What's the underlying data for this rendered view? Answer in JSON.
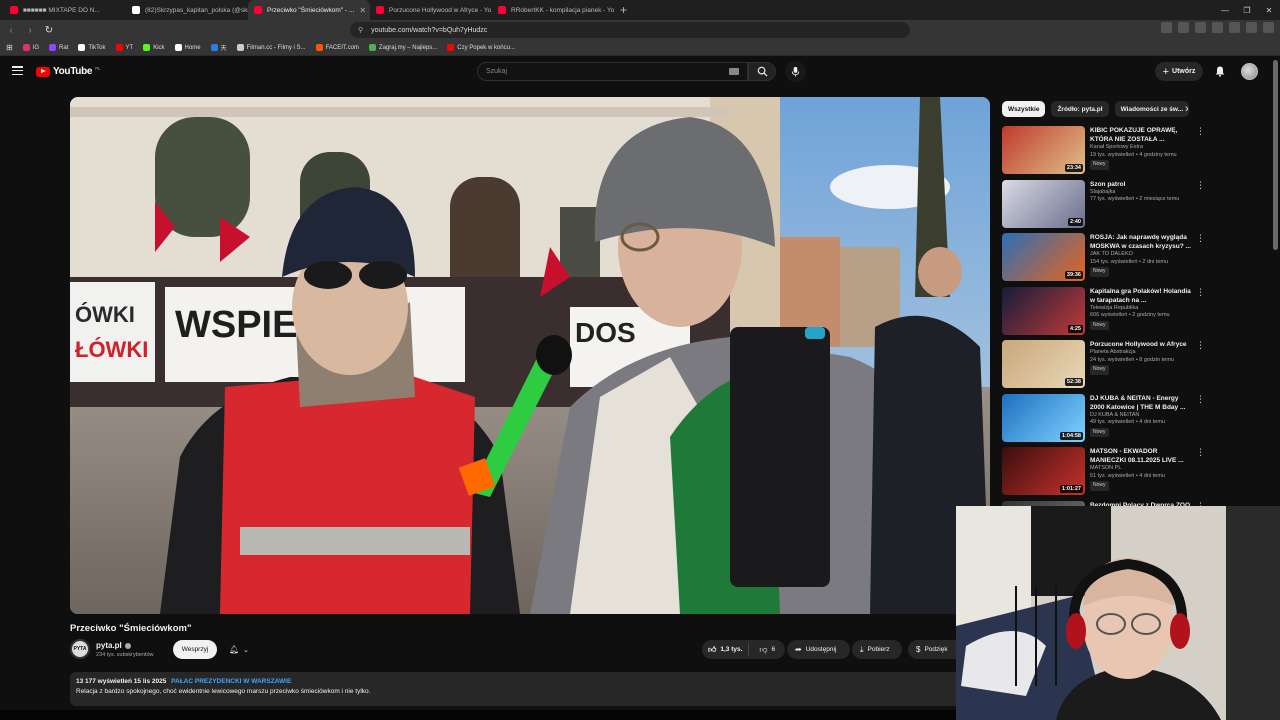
{
  "browser": {
    "tabs": [
      {
        "title": "■■■■■■ MIXTAPE DO N...",
        "color": "#ff0033"
      },
      {
        "title": "(82)Skrzypas_kapitan_polska (@skrzy...",
        "color": "#ffffff"
      },
      {
        "title": "Przeciwko \"Śmieciówkom\" - ...",
        "color": "#ff0033",
        "active": true
      },
      {
        "title": "Porzucone Hollywood w Afryce - Yo...",
        "color": "#ff0033"
      },
      {
        "title": "RRobertKK - kompilacja pianek - Yo...",
        "color": "#ff0033"
      }
    ],
    "url": "youtube.com/watch?v=bQuh7yHudzc",
    "bookmarks": [
      {
        "label": "IG",
        "color": "#e1306c"
      },
      {
        "label": "Rat",
        "color": "#9146ff"
      },
      {
        "label": "TikTok",
        "color": "#ffffff"
      },
      {
        "label": "YT",
        "color": "#ff0000"
      },
      {
        "label": "Kick",
        "color": "#53fc18"
      },
      {
        "label": "Home",
        "color": "#ffffff"
      },
      {
        "label": "天",
        "color": "#2b7de9"
      },
      {
        "label": "Filman.cc - Filmy i S...",
        "color": "#cccccc"
      },
      {
        "label": "FACEIT.com",
        "color": "#ff5500"
      },
      {
        "label": "Zagraj.my – Najleps...",
        "color": "#4caf50"
      },
      {
        "label": "Czy Popek w końcu...",
        "color": "#ff0000"
      }
    ]
  },
  "youtube": {
    "logo_text": "YouTube",
    "logo_country": "PL",
    "search_placeholder": "Szukaj",
    "create_label": "Utwórz"
  },
  "video": {
    "title": "Przeciwko \"Śmieciówkom\"",
    "channel": "pyta.pl",
    "channel_avatar_text": "PYTA",
    "subscribers": "234 tys. subskrybentów",
    "support_label": "Wesprzyj",
    "likes": "1,3 tys.",
    "dislikes": "6",
    "share_label": "Udostępnij",
    "download_label": "Pobierz",
    "thanks_label": "Podzięk",
    "views_date": "13 177 wyświetleń  15 lis 2025",
    "location_tag": "PAŁAC PREZYDENCKI W WARSZAWIE",
    "description": "Relacja z bardzo spokojnego, choć ewidentnie lewicowego marszu przeciwko śmieciówkom i nie tylko."
  },
  "sidebar": {
    "chips": [
      "Wszystkie",
      "Źródło: pyta.pl",
      "Wiadomości ze św..."
    ],
    "items": [
      {
        "title": "KIBIC POKAZUJE OPRAWĘ, KTÓRA NIE ZOSTAŁA ...",
        "channel": "Kanał Sportowy Extra",
        "meta": "19 tys. wyświetleń • 4 godziny temu",
        "duration": "23:34",
        "badge": "Nowy",
        "c1": "#c0392b",
        "c2": "#e0c08a"
      },
      {
        "title": "Szon patrol",
        "channel": "Slajabajka",
        "meta": "77 tys. wyświetleń • 2 miesiące temu",
        "duration": "2:40",
        "badge": "",
        "c1": "#d9dbe4",
        "c2": "#6b6e8f"
      },
      {
        "title": "ROSJA: Jak naprawdę wygląda MOSKWA w czasach kryzysu? ...",
        "channel": "JAK TO DALEKO",
        "meta": "154 tys. wyświetleń • 2 dni temu",
        "duration": "39:36",
        "badge": "Nowy",
        "c1": "#2a6fb5",
        "c2": "#e8641c"
      },
      {
        "title": "Kapitalna gra Polaków! Holandia w tarapatach na ...",
        "channel": "Telewizja Republika",
        "meta": "606 wyświetleń • 2 godziny temu",
        "duration": "4:25",
        "badge": "Nowy",
        "c1": "#141c3a",
        "c2": "#c23a3a"
      },
      {
        "title": "Porzucone Hollywood w Afryce",
        "channel": "Planeta Abstrakcja",
        "meta": "24 tys. wyświetleń • 8 godzin temu",
        "duration": "52:38",
        "badge": "Nowy",
        "c1": "#c9a77a",
        "c2": "#e8d8b8"
      },
      {
        "title": "DJ KUBA & NEITAN - Energy 2000 Katowice | THE M Bday ...",
        "channel": "DJ KUBA & NEITAN",
        "meta": "49 tys. wyświetleń • 4 dni temu",
        "duration": "1:04:58",
        "badge": "Nowy",
        "c1": "#1d6fbf",
        "c2": "#7fd3ff"
      },
      {
        "title": "MATSON - EKWADOR MANIECZKI 08.11.2025 LIVE ...",
        "channel": "MATSON PL",
        "meta": "51 tys. wyświetleń • 4 dni temu",
        "duration": "1:01:27",
        "badge": "Nowy",
        "c1": "#3a0e0e",
        "c2": "#c7322d"
      },
      {
        "title": "Bezdomni Polacy z Dworca ZOO ...",
        "channel": "",
        "meta": "",
        "duration": "",
        "badge": "",
        "c1": "#333333",
        "c2": "#777777"
      }
    ]
  }
}
